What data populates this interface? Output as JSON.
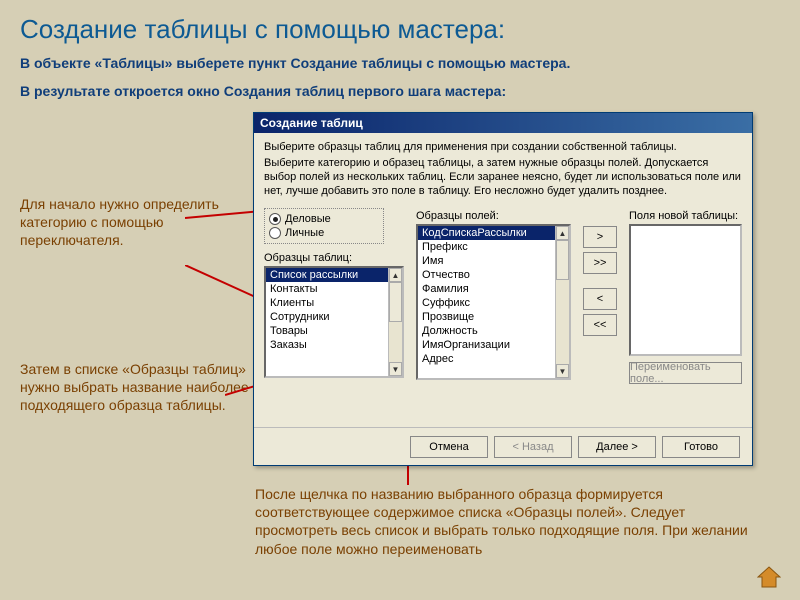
{
  "page_title": "Создание таблицы с помощью мастера:",
  "intro_1": "В объекте «Таблицы» выберете пункт Создание таблицы с помощью мастера.",
  "intro_2": "В результате откроется окно Создания таблиц первого шага мастера:",
  "note_1": "Для начало нужно определить категорию с помощью переключателя.",
  "note_2": "Затем в списке  «Образцы таблиц» нужно выбрать название наиболее подходящего образца таблицы.",
  "note_3": "После щелчка по названию выбранного образца формируется соответствующее содержимое списка «Образцы полей». Следует просмотреть весь список и выбрать только подходящие поля. При желании любое поле можно переименовать",
  "dialog": {
    "title": "Создание таблиц",
    "text1": "Выберите образцы таблиц для применения при создании собственной таблицы.",
    "text2": "Выберите категорию и образец таблицы, а затем нужные образцы полей. Допускается выбор полей из нескольких таблиц. Если заранее неясно, будет ли использоваться поле или нет, лучше добавить это поле в таблицу. Его несложно будет удалить позднее.",
    "radio_business": "Деловые",
    "radio_personal": "Личные",
    "label_sample_tables": "Образцы таблиц:",
    "label_sample_fields": "Образцы полей:",
    "label_new_fields": "Поля новой таблицы:",
    "sample_tables": [
      "Список рассылки",
      "Контакты",
      "Клиенты",
      "Сотрудники",
      "Товары",
      "Заказы"
    ],
    "sample_fields": [
      "КодСпискаРассылки",
      "Префикс",
      "Имя",
      "Отчество",
      "Фамилия",
      "Суффикс",
      "Прозвище",
      "Должность",
      "ИмяОрганизации",
      "Адрес"
    ],
    "btn_add": ">",
    "btn_add_all": ">>",
    "btn_remove": "<",
    "btn_remove_all": "<<",
    "btn_rename": "Переименовать поле...",
    "footer": {
      "cancel": "Отмена",
      "back": "< Назад",
      "next": "Далее >",
      "finish": "Готово"
    }
  }
}
